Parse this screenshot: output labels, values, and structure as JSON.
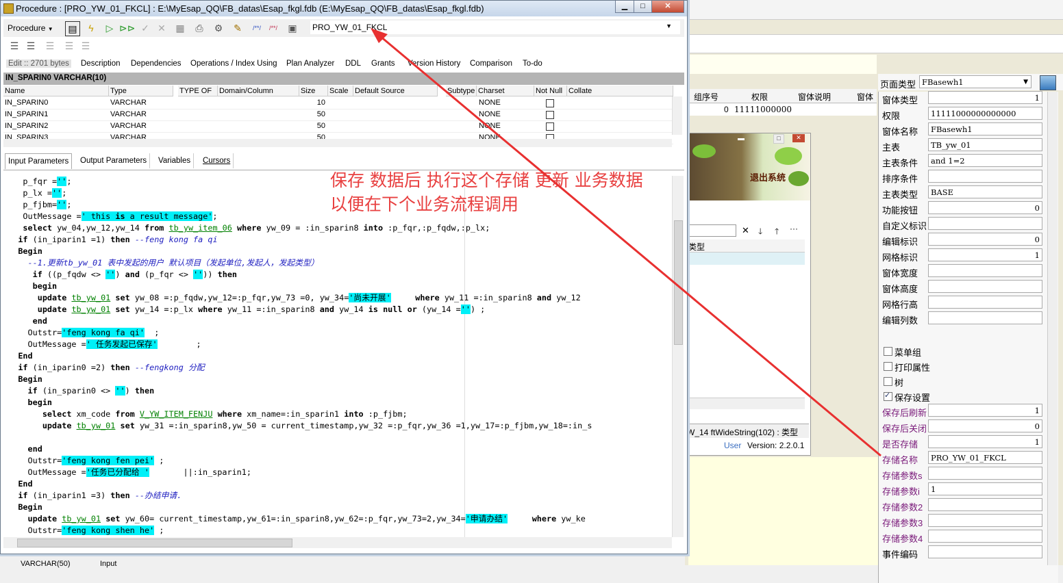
{
  "main_window": {
    "title": "Procedure : [PRO_YW_01_FKCL] : E:\\MyEsap_QQ\\FB_datas\\Esap_fkgl.fdb (E:\\MyEsap_QQ\\FB_datas\\Esap_fkgl.fdb)",
    "toolbar": {
      "procedure_menu": "Procedure",
      "procedure_combo": "PRO_YW_01_FKCL"
    },
    "tabs": [
      "Edit :: 2701 bytes",
      "Description",
      "Dependencies",
      "Operations / Index Using",
      "Plan Analyzer",
      "DDL",
      "Grants",
      "Version History",
      "Comparison",
      "To-do"
    ],
    "section_header": "IN_SPARIN0 VARCHAR(10)",
    "param_grid": {
      "columns": [
        "Name",
        "Type",
        "TYPE OF",
        "Domain/Column",
        "Size",
        "Scale",
        "Default Source",
        "Subtype",
        "Charset",
        "Not Null",
        "Collate"
      ],
      "rows": [
        {
          "name": "IN_SPARIN0",
          "type": "VARCHAR",
          "size": "10",
          "charset": "NONE"
        },
        {
          "name": "IN_SPARIN1",
          "type": "VARCHAR",
          "size": "50",
          "charset": "NONE"
        },
        {
          "name": "IN_SPARIN2",
          "type": "VARCHAR",
          "size": "50",
          "charset": "NONE"
        },
        {
          "name": "IN_SPARIN3",
          "type": "VARCHAR",
          "size": "50",
          "charset": "NONE"
        }
      ]
    },
    "param_tabs": [
      "Input Parameters",
      "Output Parameters",
      "Variables",
      "Cursors"
    ],
    "footer_fragment": [
      "VARCHAR(50)",
      "Input"
    ]
  },
  "code_lines": [
    "    p_fqr ='';",
    "    p_lx ='';",
    "    p_fjbm='';",
    "    OutMessage =' this is a result message';",
    "    select yw_04,yw_12,yw_14 from tb_yw_item_06 where yw_09 = :in_sparin8 into :p_fqr,:p_fqdw,:p_lx;",
    "   if (in_iparin1 =1) then --feng kong fa qi",
    "   Begin",
    "     --1.更新tb_yw_01 表中发起的用户 默认项目（发起单位,发起人，发起类型）",
    "      if ((p_fqdw <> '') and (p_fqr <> '')) then",
    "      begin",
    "       update tb_yw_01 set yw_08 =:p_fqdw,yw_12=:p_fqr,yw_73 =0, yw_34='尚未开展'     where yw_11 =:in_sparin8 and yw_12",
    "       update tb_yw_01 set yw_14 =:p_lx where yw_11 =:in_sparin8 and yw_14 is null or (yw_14 ='') ;",
    "      end",
    "     Outstr='feng kong fa qi'  ;",
    "     OutMessage =' 任务发起已保存'        ;",
    "   End",
    "   if (in_iparin0 =2) then --fengkong 分配",
    "   Begin",
    "     if (in_sparin0 <> '') then",
    "     begin",
    "        select xm_code from V_YW_ITEM_FENJU where xm_name=:in_sparin1 into :p_fjbm;",
    "        update tb_yw_01 set yw_31 =:in_sparin8,yw_50 = current_timestamp,yw_32 =:p_fqr,yw_36 =1,yw_17=:p_fjbm,yw_18=:in_s",
    "",
    "     end",
    "     Outstr='feng kong fen pei' ;",
    "     OutMessage ='任务已分配给 '       ||:in_sparin1;",
    "   End",
    "   if (in_iparin1 =3) then --办结申请.",
    "   Begin",
    "     update tb_yw_01 set yw_60= current_timestamp,yw_61=:in_sparin8,yw_62=:p_fqr,yw_73=2,yw_34='申请办结'     where yw_ke",
    "     Outstr='feng kong shen he' ;"
  ],
  "annotation": {
    "line1": "保存  数据后  执行这个存储  更新  业务数据",
    "line2": "以便在下个业务流程调用",
    "arrow_color": "#e83030"
  },
  "background_app": {
    "grid_headers": [
      "组序号",
      "权限",
      "窗体说明",
      "窗体"
    ],
    "grid_row": {
      "num": "0",
      "perm": "11111000000"
    },
    "child_window": {
      "exit_button": "退出系统",
      "column_header": "类型",
      "status": "W_14 ftWideString(102) : 类型",
      "user_label": "User",
      "version": "Version: 2.2.0.1"
    }
  },
  "right_panel": {
    "page_type_label": "页面类型",
    "page_type_value": "FBasewh1",
    "fields": [
      {
        "label": "窗体类型",
        "value": "1",
        "num": true,
        "purple": false
      },
      {
        "label": "权限",
        "value": "11111000000000000",
        "num": false,
        "purple": false
      },
      {
        "label": "窗体名称",
        "value": "FBasewh1",
        "num": false,
        "purple": false
      },
      {
        "label": "主表",
        "value": "TB_yw_01",
        "num": false,
        "purple": false
      },
      {
        "label": "主表条件",
        "value": "and 1=2",
        "num": false,
        "purple": false
      },
      {
        "label": "排序条件",
        "value": "",
        "num": false,
        "purple": false
      },
      {
        "label": "主表类型",
        "value": "BASE",
        "num": false,
        "purple": false
      },
      {
        "label": "功能按钮",
        "value": "0",
        "num": true,
        "purple": false
      },
      {
        "label": "自定义标识",
        "value": "",
        "num": false,
        "purple": false
      },
      {
        "label": "编辑标识",
        "value": "0",
        "num": true,
        "purple": false
      },
      {
        "label": "网格标识",
        "value": "1",
        "num": true,
        "purple": false
      },
      {
        "label": "窗体宽度",
        "value": "",
        "num": false,
        "purple": false
      },
      {
        "label": "窗体高度",
        "value": "",
        "num": false,
        "purple": false
      },
      {
        "label": "网格行高",
        "value": "",
        "num": false,
        "purple": false
      },
      {
        "label": "编辑列数",
        "value": "",
        "num": false,
        "purple": false
      }
    ],
    "checks": [
      {
        "label": "菜单组",
        "checked": false
      },
      {
        "label": "打印属性",
        "checked": false
      },
      {
        "label": "树",
        "checked": false
      },
      {
        "label": "保存设置",
        "checked": true
      }
    ],
    "save_fields": [
      {
        "label": "保存后刷新",
        "value": "1",
        "num": true,
        "purple": true
      },
      {
        "label": "保存后关闭",
        "value": "0",
        "num": true,
        "purple": true
      },
      {
        "label": "是否存储",
        "value": "1",
        "num": true,
        "purple": true
      },
      {
        "label": "存储名称",
        "value": "PRO_YW_01_FKCL",
        "num": false,
        "purple": true
      },
      {
        "label": "存储参数s",
        "value": "",
        "num": false,
        "purple": true
      },
      {
        "label": "存储参数i",
        "value": "1",
        "num": false,
        "purple": true
      },
      {
        "label": "存储参数2",
        "value": "",
        "num": false,
        "purple": true
      },
      {
        "label": "存储参数3",
        "value": "",
        "num": false,
        "purple": true
      },
      {
        "label": "存储参数4",
        "value": "",
        "num": false,
        "purple": true
      },
      {
        "label": "事件编码",
        "value": "",
        "num": false,
        "purple": false
      }
    ]
  }
}
